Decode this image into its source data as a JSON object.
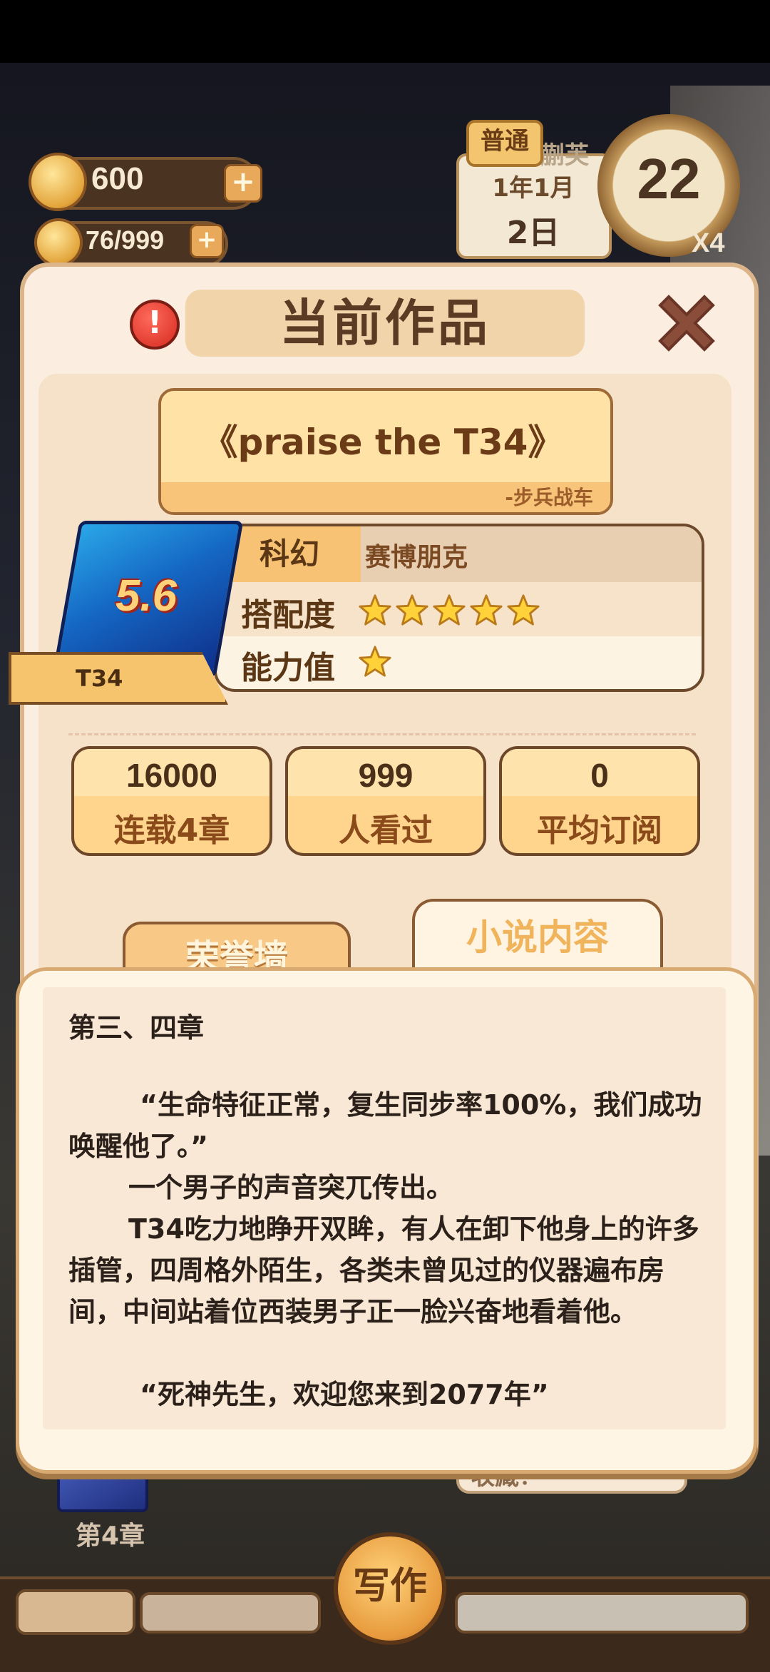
{
  "currency": {
    "coins": "600",
    "energy": "76/999"
  },
  "date_widget": {
    "mode": "普通",
    "partial_label": "蒯芙",
    "year_month": "1年1月",
    "day": "2日",
    "clock_value": "22",
    "speed": "X4"
  },
  "panel": {
    "title": "当前作品",
    "alert_glyph": "!"
  },
  "work": {
    "title": "《praise the T34》",
    "subtitle": "-步兵战车",
    "genre": "科幻",
    "subgenre": "赛博朋克",
    "match_label": "搭配度",
    "match_stars": 5,
    "ability_label": "能力值",
    "ability_stars": 1,
    "book_score": "5.6",
    "book_name": "T34"
  },
  "stats": [
    {
      "value": "16000",
      "label": "连载4章"
    },
    {
      "value": "999",
      "label": "人看过"
    },
    {
      "value": "0",
      "label": "平均订阅"
    }
  ],
  "tabs": {
    "honor": "荣誉墙",
    "content": "小说内容"
  },
  "content": {
    "heading": "第三、四章",
    "paragraphs": [
      "“生命特征正常，复生同步率100%，我们成功唤醒他了。”",
      "一个男子的声音突兀传出。",
      "T34吃力地睁开双眸，有人在卸下他身上的许多插管，四周格外陌生，各类未曾见过的仪器遍布房间，中间站着位西装男子正一脸兴奋地看着他。",
      "“死神先生，欢迎您来到2077年”"
    ]
  },
  "background": {
    "chapter_label": "第4章",
    "card_text": "收藏？"
  },
  "bottom_nav": {
    "write_label": "写作"
  },
  "colors": {
    "panel_bg": "#fbeee0",
    "accent": "#f7c273",
    "text_dark": "#2b211a",
    "star": "#ffd23a"
  }
}
